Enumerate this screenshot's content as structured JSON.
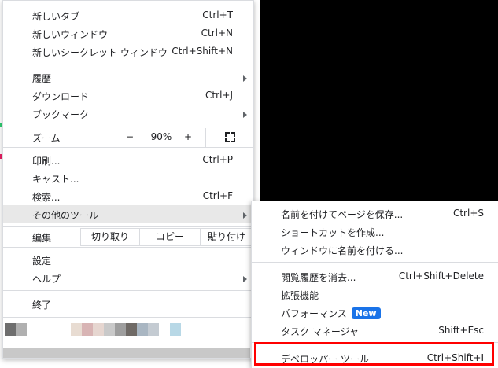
{
  "menu": {
    "new_tab": {
      "label": "新しいタブ",
      "shortcut": "Ctrl+T"
    },
    "new_window": {
      "label": "新しいウィンドウ",
      "shortcut": "Ctrl+N"
    },
    "new_incognito": {
      "label": "新しいシークレット ウィンドウ",
      "shortcut": "Ctrl+Shift+N"
    },
    "history": {
      "label": "履歴"
    },
    "downloads": {
      "label": "ダウンロード",
      "shortcut": "Ctrl+J"
    },
    "bookmarks": {
      "label": "ブックマーク"
    },
    "zoom": {
      "label": "ズーム",
      "minus": "−",
      "value": "90%",
      "plus": "+"
    },
    "print": {
      "label": "印刷...",
      "shortcut": "Ctrl+P"
    },
    "cast": {
      "label": "キャスト..."
    },
    "search": {
      "label": "検索...",
      "shortcut": "Ctrl+F"
    },
    "more_tools": {
      "label": "その他のツール"
    },
    "edit": {
      "label": "編集",
      "cut": "切り取り",
      "copy": "コピー",
      "paste": "貼り付け"
    },
    "settings": {
      "label": "設定"
    },
    "help": {
      "label": "ヘルプ"
    },
    "exit": {
      "label": "終了"
    }
  },
  "submenu": {
    "save_page": {
      "label": "名前を付けてページを保存...",
      "shortcut": "Ctrl+S"
    },
    "create_shortcut": {
      "label": "ショートカットを作成..."
    },
    "name_window": {
      "label": "ウィンドウに名前を付ける..."
    },
    "clear_data": {
      "label": "閲覧履歴を消去...",
      "shortcut": "Ctrl+Shift+Delete"
    },
    "extensions": {
      "label": "拡張機能"
    },
    "performance": {
      "label": "パフォーマンス",
      "badge": "New"
    },
    "task_manager": {
      "label": "タスク マネージャ",
      "shortcut": "Shift+Esc"
    },
    "dev_tools": {
      "label": "デベロッパー ツール",
      "shortcut": "Ctrl+Shift+I"
    }
  },
  "colors": {
    "accent": "#1a73e8",
    "highlight": "#e8e8e8",
    "callout": "#ff0000"
  }
}
